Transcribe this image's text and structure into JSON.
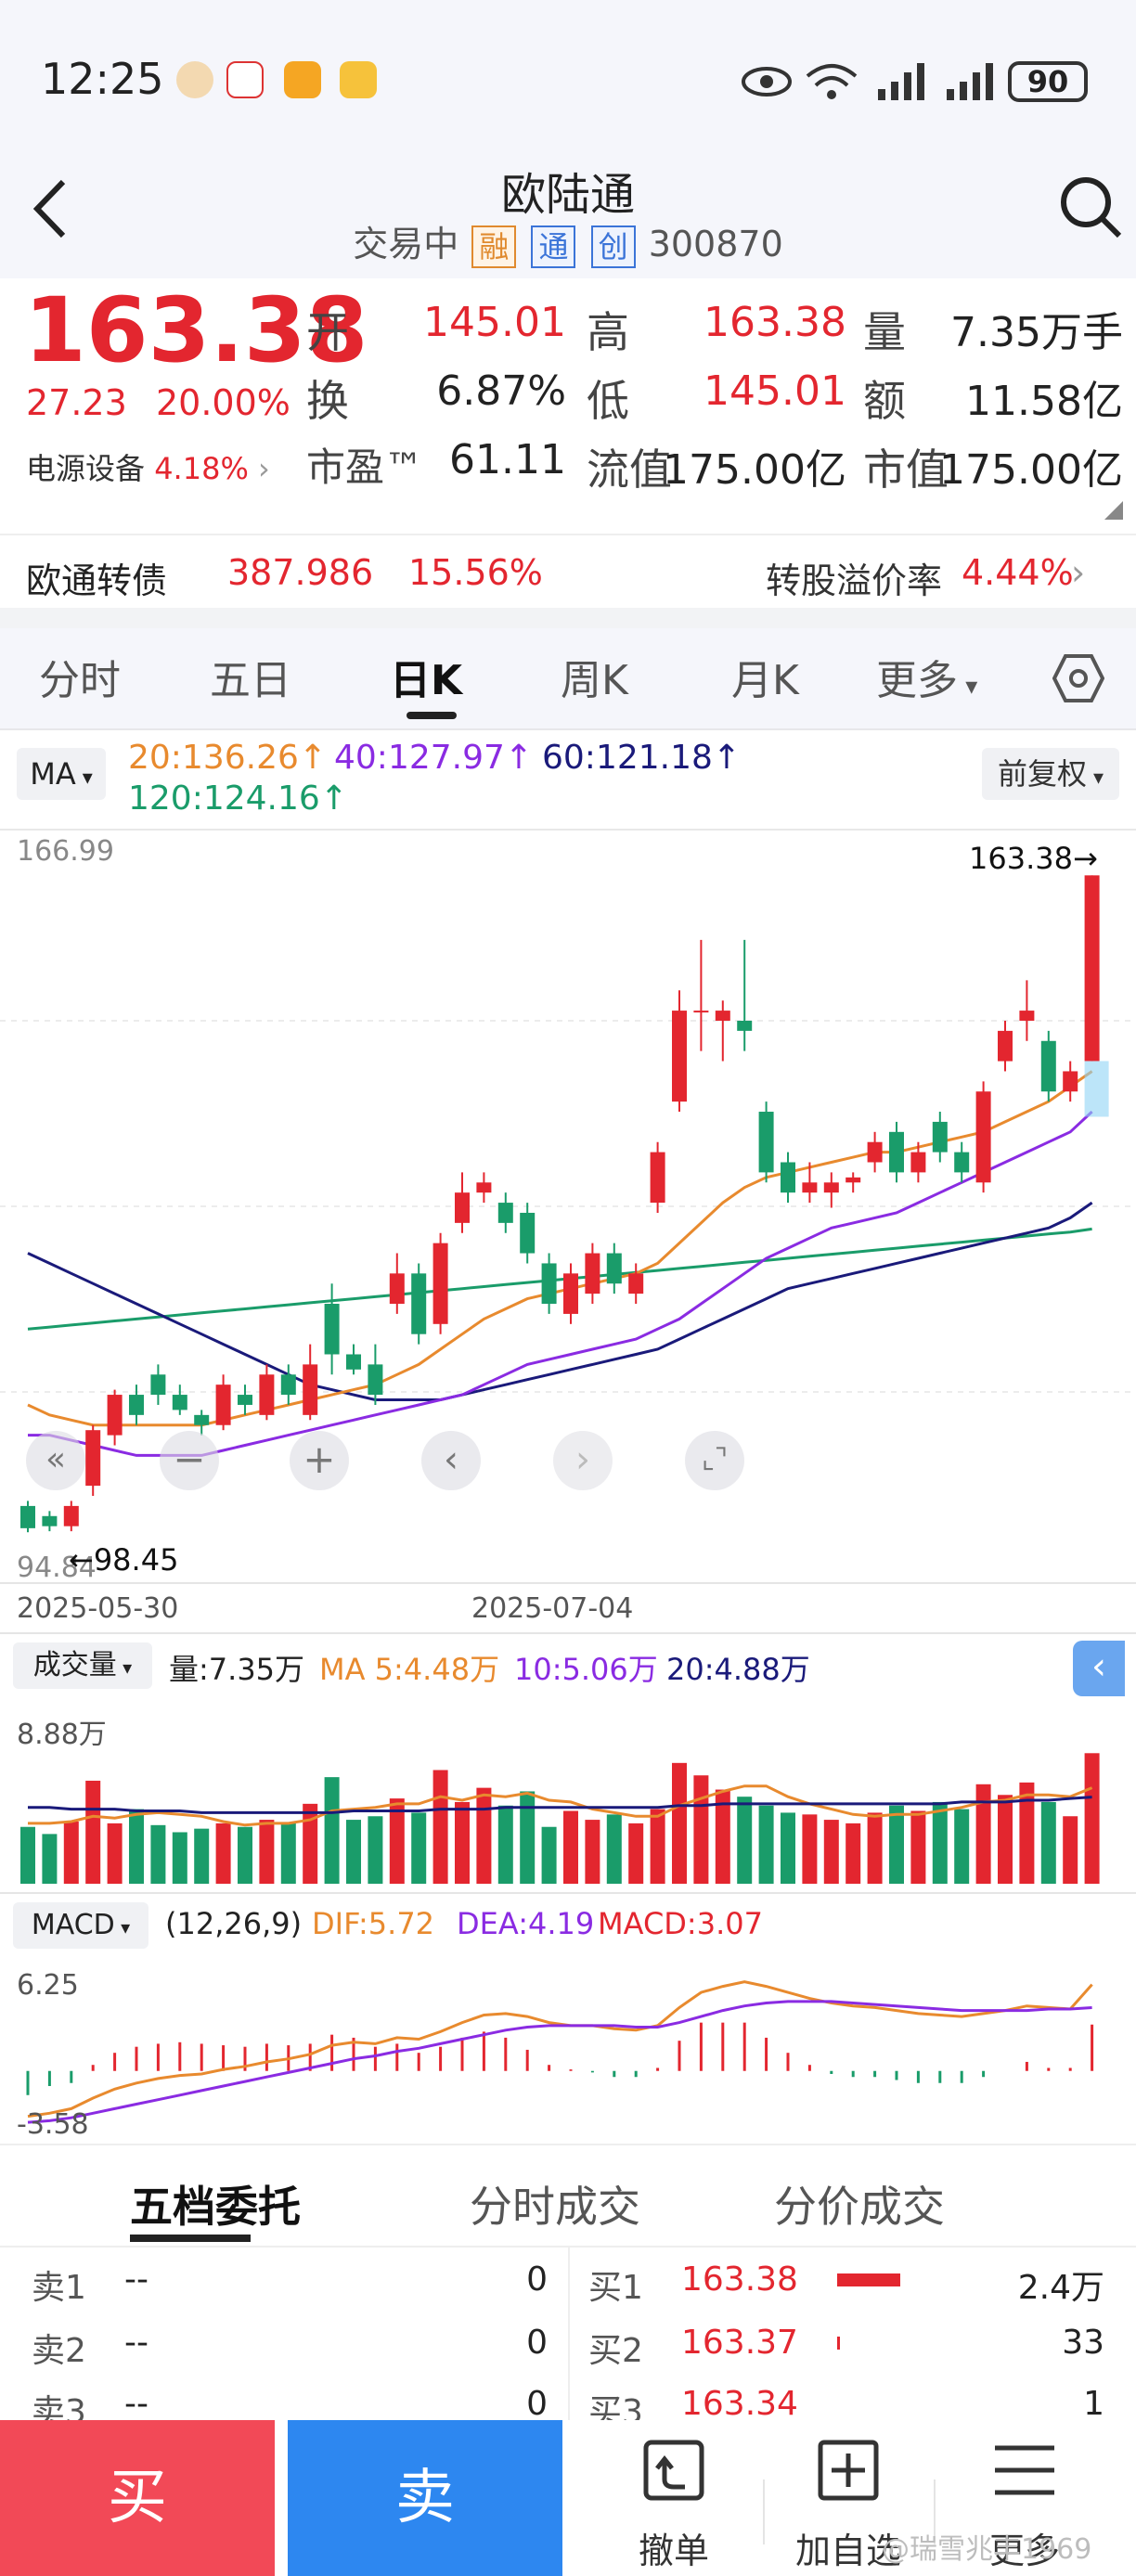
{
  "status_bar": {
    "time": "12:25",
    "battery": "90"
  },
  "header": {
    "title": "欧陆通",
    "status": "交易中",
    "tags": [
      "融",
      "通",
      "创"
    ],
    "code": "300870"
  },
  "quote": {
    "price": "163.38",
    "change": "27.23",
    "change_pct": "20.00%",
    "sector": "电源设备",
    "sector_pct": "4.18%",
    "fields": [
      {
        "label": "开",
        "value": "145.01",
        "red": true
      },
      {
        "label": "高",
        "value": "163.38",
        "red": true
      },
      {
        "label": "量",
        "value": "7.35万手",
        "red": false
      },
      {
        "label": "换",
        "value": "6.87%",
        "red": false
      },
      {
        "label": "低",
        "value": "145.01",
        "red": true
      },
      {
        "label": "额",
        "value": "11.58亿",
        "red": false
      },
      {
        "label": "市盈™",
        "value": "61.11",
        "red": false
      },
      {
        "label": "流值",
        "value": "175.00亿",
        "red": false
      },
      {
        "label": "市值",
        "value": "175.00亿",
        "red": false
      }
    ]
  },
  "bond": {
    "name": "欧通转债",
    "price": "387.986",
    "pct": "15.56%",
    "premium_label": "转股溢价率",
    "premium": "4.44%"
  },
  "tabs": [
    "分时",
    "五日",
    "日K",
    "周K",
    "月K",
    "更多"
  ],
  "active_tab": "日K",
  "ma": {
    "button": "MA",
    "ma20": "20:136.26↑",
    "ma40": "40:127.97↑",
    "ma60": "60:121.18↑",
    "ma120": "120:124.16↑",
    "adjust": "前复权"
  },
  "kline": {
    "y_top": "166.99",
    "y_bottom": "94.84",
    "high_marker": "163.38→",
    "low_marker": "←98.45",
    "date_left": "2025-05-30",
    "date_mid": "2025-07-04"
  },
  "volume": {
    "button": "成交量",
    "amount": "量:7.35万",
    "ma5": "MA 5:4.48万",
    "ma10": "10:5.06万",
    "ma20": "20:4.88万",
    "axis_max": "8.88万"
  },
  "macd": {
    "button": "MACD",
    "params": "(12,26,9)",
    "dif": "DIF:5.72",
    "dea": "DEA:4.19",
    "macd": "MACD:3.07",
    "axis_max": "6.25",
    "axis_min": "-3.58"
  },
  "order_tabs": [
    "五档委托",
    "分时成交",
    "分价成交"
  ],
  "sell_rows": [
    {
      "label": "卖1",
      "price": "--",
      "qty": "0"
    },
    {
      "label": "卖2",
      "price": "--",
      "qty": "0"
    },
    {
      "label": "卖3",
      "price": "--",
      "qty": "0"
    }
  ],
  "buy_rows": [
    {
      "label": "买1",
      "price": "163.38",
      "qty": "2.4万"
    },
    {
      "label": "买2",
      "price": "163.37",
      "qty": "33"
    },
    {
      "label": "买3",
      "price": "163.34",
      "qty": "1"
    }
  ],
  "actions": {
    "buy": "买",
    "sell": "卖",
    "cancel": "撤单",
    "add": "加自选",
    "more": "更多"
  },
  "watermark": "@瑞雪兆丰1969",
  "colors": {
    "up": "#e3262f",
    "down": "#1a9c6a",
    "ma20": "#e88a2e",
    "ma40": "#8a2be2",
    "ma60": "#1a1a7a",
    "ma120": "#1a9c6a"
  },
  "candles": [
    {
      "o": 101,
      "c": 98.8,
      "h": 101.5,
      "l": 98.4
    },
    {
      "o": 100,
      "c": 99,
      "h": 100.5,
      "l": 98.5
    },
    {
      "o": 99,
      "c": 101,
      "h": 101.5,
      "l": 98.5
    },
    {
      "o": 103,
      "c": 108.5,
      "h": 109,
      "l": 102
    },
    {
      "o": 108,
      "c": 112,
      "h": 112.5,
      "l": 107
    },
    {
      "o": 112,
      "c": 110,
      "h": 113,
      "l": 109
    },
    {
      "o": 114,
      "c": 112,
      "h": 115,
      "l": 111
    },
    {
      "o": 112,
      "c": 110.5,
      "h": 113,
      "l": 110
    },
    {
      "o": 110,
      "c": 109,
      "h": 110.5,
      "l": 108
    },
    {
      "o": 109,
      "c": 113,
      "h": 114,
      "l": 108.5
    },
    {
      "o": 112,
      "c": 111,
      "h": 113,
      "l": 110
    },
    {
      "o": 110,
      "c": 114,
      "h": 115,
      "l": 109.5
    },
    {
      "o": 114,
      "c": 112,
      "h": 115,
      "l": 111
    },
    {
      "o": 110,
      "c": 115,
      "h": 117,
      "l": 109.5
    },
    {
      "o": 121,
      "c": 116,
      "h": 123,
      "l": 114
    },
    {
      "o": 116,
      "c": 114.5,
      "h": 117,
      "l": 114
    },
    {
      "o": 115,
      "c": 112,
      "h": 117,
      "l": 111
    },
    {
      "o": 121,
      "c": 124,
      "h": 126,
      "l": 120
    },
    {
      "o": 124,
      "c": 118,
      "h": 125,
      "l": 117
    },
    {
      "o": 119,
      "c": 127,
      "h": 128,
      "l": 118
    },
    {
      "o": 129,
      "c": 132,
      "h": 134,
      "l": 128
    },
    {
      "o": 132,
      "c": 133,
      "h": 134,
      "l": 131
    },
    {
      "o": 131,
      "c": 129,
      "h": 132,
      "l": 128
    },
    {
      "o": 130,
      "c": 126,
      "h": 131,
      "l": 125
    },
    {
      "o": 125,
      "c": 121,
      "h": 126,
      "l": 120
    },
    {
      "o": 120,
      "c": 124,
      "h": 125,
      "l": 119
    },
    {
      "o": 122,
      "c": 126,
      "h": 127,
      "l": 121
    },
    {
      "o": 126,
      "c": 123,
      "h": 127,
      "l": 122
    },
    {
      "o": 122,
      "c": 124,
      "h": 125,
      "l": 121
    },
    {
      "o": 131,
      "c": 136,
      "h": 137,
      "l": 130
    },
    {
      "o": 141,
      "c": 150,
      "h": 152,
      "l": 140
    },
    {
      "o": 150,
      "c": 150,
      "h": 157,
      "l": 146
    },
    {
      "o": 149,
      "c": 150,
      "h": 151,
      "l": 145
    },
    {
      "o": 149,
      "c": 148,
      "h": 157,
      "l": 146
    },
    {
      "o": 140,
      "c": 134,
      "h": 141,
      "l": 133
    },
    {
      "o": 135,
      "c": 132,
      "h": 136,
      "l": 131
    },
    {
      "o": 132,
      "c": 133,
      "h": 135,
      "l": 131
    },
    {
      "o": 132,
      "c": 133,
      "h": 134,
      "l": 130.5
    },
    {
      "o": 133,
      "c": 133.5,
      "h": 134,
      "l": 132
    },
    {
      "o": 135,
      "c": 137,
      "h": 138,
      "l": 134
    },
    {
      "o": 138,
      "c": 134,
      "h": 139,
      "l": 133
    },
    {
      "o": 134,
      "c": 136,
      "h": 137,
      "l": 133
    },
    {
      "o": 139,
      "c": 136,
      "h": 140,
      "l": 135
    },
    {
      "o": 136,
      "c": 134,
      "h": 137,
      "l": 133
    },
    {
      "o": 133,
      "c": 142,
      "h": 143,
      "l": 132
    },
    {
      "o": 145,
      "c": 148,
      "h": 149,
      "l": 144
    },
    {
      "o": 149,
      "c": 150,
      "h": 153,
      "l": 147
    },
    {
      "o": 147,
      "c": 142,
      "h": 148,
      "l": 141
    },
    {
      "o": 142,
      "c": 144,
      "h": 145,
      "l": 141
    },
    {
      "o": 145.01,
      "c": 163.38,
      "h": 163.38,
      "l": 145.01
    }
  ],
  "ma20_line": [
    111,
    110,
    109.5,
    109,
    109,
    109,
    109,
    109,
    109,
    109.5,
    110,
    110.5,
    111,
    111.5,
    112,
    112.5,
    113,
    114,
    115,
    116.5,
    118,
    119.5,
    120.5,
    121.5,
    122,
    122.5,
    123,
    123.5,
    124,
    125,
    127,
    129,
    131,
    132.5,
    133.5,
    134,
    134.5,
    135,
    135.5,
    136,
    136,
    136.5,
    137,
    137.5,
    138,
    139,
    140,
    141,
    142.5,
    144
  ],
  "ma40_line": [
    108,
    108,
    107.5,
    107,
    106.5,
    106,
    106,
    106,
    106,
    106.5,
    107,
    107.5,
    108,
    108.5,
    109,
    109.5,
    110,
    110.5,
    111,
    111.5,
    112,
    113,
    114,
    115,
    115.5,
    116,
    116.5,
    117,
    117.5,
    118.5,
    119.5,
    121,
    122.5,
    124,
    125.5,
    126.5,
    127.5,
    128.5,
    129,
    129.5,
    130,
    131,
    132,
    133,
    134,
    135,
    136,
    137,
    138,
    140
  ],
  "ma60_line": [
    126,
    125,
    124,
    123,
    122,
    121,
    120,
    119,
    118,
    117,
    116,
    115,
    114,
    113,
    112.5,
    112,
    111.5,
    111.5,
    111.5,
    111.5,
    112,
    112.5,
    113,
    113.5,
    114,
    114.5,
    115,
    115.5,
    116,
    116.5,
    117.5,
    118.5,
    119.5,
    120.5,
    121.5,
    122.5,
    123,
    123.5,
    124,
    124.5,
    125,
    125.5,
    126,
    126.5,
    127,
    127.5,
    128,
    128.5,
    129.5,
    131
  ],
  "ma120_line": [
    118.5,
    118.7,
    118.9,
    119.1,
    119.3,
    119.5,
    119.7,
    119.9,
    120.1,
    120.3,
    120.5,
    120.7,
    120.9,
    121.1,
    121.3,
    121.5,
    121.7,
    121.9,
    122.1,
    122.3,
    122.5,
    122.7,
    122.9,
    123.1,
    123.3,
    123.5,
    123.7,
    123.9,
    124.1,
    124.3,
    124.5,
    124.7,
    124.9,
    125.1,
    125.3,
    125.5,
    125.7,
    125.9,
    126.1,
    126.3,
    126.5,
    126.7,
    126.9,
    127.1,
    127.3,
    127.5,
    127.7,
    127.9,
    128.1,
    128.4
  ],
  "volumes": [
    3.2,
    2.8,
    3.5,
    5.8,
    3.4,
    4.2,
    3.3,
    2.9,
    3.1,
    3.4,
    3.2,
    3.6,
    3.4,
    4.5,
    6.0,
    3.6,
    3.8,
    4.8,
    4.0,
    6.4,
    4.6,
    5.4,
    4.4,
    5.2,
    3.2,
    4.1,
    3.6,
    3.9,
    3.4,
    4.2,
    6.8,
    6.1,
    5.3,
    4.9,
    4.4,
    4.0,
    3.9,
    3.6,
    3.4,
    4.0,
    4.4,
    4.1,
    4.6,
    4.2,
    5.6,
    5.0,
    5.7,
    4.6,
    3.8,
    7.35
  ],
  "vol_ma5": [
    3.4,
    3.4,
    3.5,
    3.8,
    3.7,
    3.9,
    4.0,
    3.9,
    3.8,
    3.5,
    3.3,
    3.4,
    3.4,
    3.6,
    4.1,
    4.2,
    4.3,
    4.5,
    4.5,
    4.9,
    4.7,
    5.0,
    4.9,
    5.1,
    4.7,
    4.6,
    4.2,
    4.0,
    3.8,
    3.8,
    4.4,
    4.8,
    5.2,
    5.5,
    5.5,
    4.9,
    4.5,
    4.2,
    3.9,
    3.8,
    3.9,
    3.9,
    4.1,
    4.3,
    4.6,
    4.7,
    5.0,
    5.0,
    4.9,
    5.4
  ],
  "vol_ma20": [
    4.3,
    4.3,
    4.2,
    4.2,
    4.2,
    4.1,
    4.1,
    4.1,
    4.0,
    4.0,
    4.0,
    4.0,
    4.0,
    4.0,
    4.0,
    4.1,
    4.1,
    4.1,
    4.1,
    4.2,
    4.2,
    4.2,
    4.3,
    4.3,
    4.3,
    4.3,
    4.3,
    4.3,
    4.3,
    4.3,
    4.4,
    4.4,
    4.5,
    4.5,
    4.5,
    4.5,
    4.5,
    4.5,
    4.5,
    4.5,
    4.5,
    4.5,
    4.5,
    4.6,
    4.6,
    4.6,
    4.7,
    4.7,
    4.8,
    4.88
  ],
  "dif": [
    -3.0,
    -2.8,
    -2.5,
    -1.8,
    -1.2,
    -0.8,
    -0.5,
    -0.3,
    -0.2,
    0.1,
    0.3,
    0.6,
    0.8,
    1.1,
    1.7,
    1.9,
    1.8,
    2.2,
    2.1,
    2.6,
    3.2,
    3.7,
    3.8,
    3.6,
    3.2,
    3.0,
    3.0,
    2.8,
    2.7,
    3.0,
    4.2,
    5.2,
    5.6,
    5.9,
    5.6,
    5.2,
    4.8,
    4.5,
    4.3,
    4.2,
    4.0,
    3.8,
    3.7,
    3.6,
    3.8,
    4.0,
    4.3,
    4.2,
    4.1,
    5.72
  ],
  "dea": [
    -3.4,
    -3.3,
    -3.1,
    -2.8,
    -2.5,
    -2.2,
    -1.9,
    -1.6,
    -1.3,
    -1.0,
    -0.7,
    -0.4,
    -0.1,
    0.2,
    0.5,
    0.8,
    1.0,
    1.3,
    1.5,
    1.8,
    2.1,
    2.4,
    2.7,
    2.9,
    3.0,
    3.0,
    3.0,
    3.0,
    2.9,
    2.9,
    3.2,
    3.6,
    4.0,
    4.3,
    4.5,
    4.6,
    4.6,
    4.6,
    4.5,
    4.4,
    4.3,
    4.2,
    4.1,
    4.0,
    4.0,
    4.0,
    4.0,
    4.1,
    4.1,
    4.19
  ],
  "macd_bars": [
    -1.6,
    -1.0,
    -0.8,
    0.4,
    1.2,
    1.6,
    1.8,
    1.9,
    1.8,
    1.7,
    1.6,
    1.8,
    1.7,
    1.8,
    2.4,
    2.2,
    1.6,
    1.8,
    1.2,
    1.6,
    2.2,
    2.6,
    2.2,
    1.4,
    0.4,
    0.1,
    -0.1,
    -0.4,
    -0.4,
    0.2,
    2.0,
    3.2,
    3.2,
    3.2,
    2.2,
    1.2,
    0.4,
    -0.2,
    -0.4,
    -0.4,
    -0.6,
    -0.8,
    -0.8,
    -0.8,
    -0.4,
    0.0,
    0.6,
    0.2,
    0.2,
    3.07
  ]
}
